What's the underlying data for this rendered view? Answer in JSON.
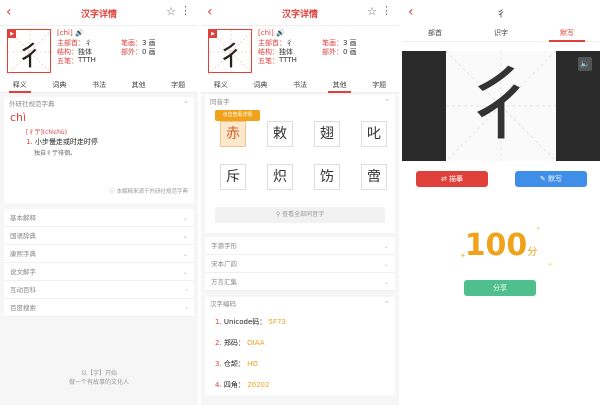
{
  "app": {
    "title": "汉字详情",
    "char": "彳",
    "pinyin": "[chì]",
    "info": {
      "radical_label": "主部首：",
      "radical": "彳",
      "strokes_label": "笔画：",
      "strokes": "3 画",
      "structure_label": "结构：",
      "structure": "独体",
      "other_label": "部外：",
      "other": "0 画",
      "wubi_label": "五笔：",
      "wubi": "TTTH"
    },
    "tabs": [
      "释义",
      "词典",
      "书法",
      "其他",
      "字题"
    ]
  },
  "panel1": {
    "dict_title": "外研社规范字典",
    "pinyin_large": "chì",
    "sub": "[彳亍](chìchù)",
    "def_num": "1.",
    "def": "小步慢走或时走时停",
    "example": "独自彳亍徘徊。",
    "source": "本解释来源于外研社规范字典",
    "sections": [
      "基本解释",
      "国语辞典",
      "康熙字典",
      "说文解字",
      "互动百科",
      "百度搜索"
    ],
    "footer1": "以【字】开始",
    "footer2": "做一个有故事的文化人"
  },
  "panel2": {
    "homophone_title": "同音字",
    "tooltip": "点击查看详情",
    "homophones": [
      "赤",
      "敕",
      "翅",
      "叱",
      "斥",
      "炽",
      "饬",
      "啻"
    ],
    "view_all": "查看全部同音字",
    "sections": [
      "字源字形",
      "宋本广韵",
      "方言汇集"
    ],
    "code_title": "汉字编码",
    "codes": [
      {
        "num": "1.",
        "label": "Unicode码：",
        "value": "5F73"
      },
      {
        "num": "2.",
        "label": "郑码：",
        "value": "OIAA"
      },
      {
        "num": "3.",
        "label": "仓颉：",
        "value": "HO"
      },
      {
        "num": "4.",
        "label": "四角：",
        "value": "20202"
      }
    ]
  },
  "panel3": {
    "title_char": "彳",
    "tabs": [
      "部首",
      "识字",
      "默写"
    ],
    "trace_button": "描摹",
    "write_button": "默写",
    "score": "100",
    "score_unit": "分",
    "share_button": "分享"
  },
  "colors": {
    "accent": "#e0403a",
    "blue": "#3f8ee8",
    "green": "#4fc08d",
    "gold": "#f1a21b"
  }
}
